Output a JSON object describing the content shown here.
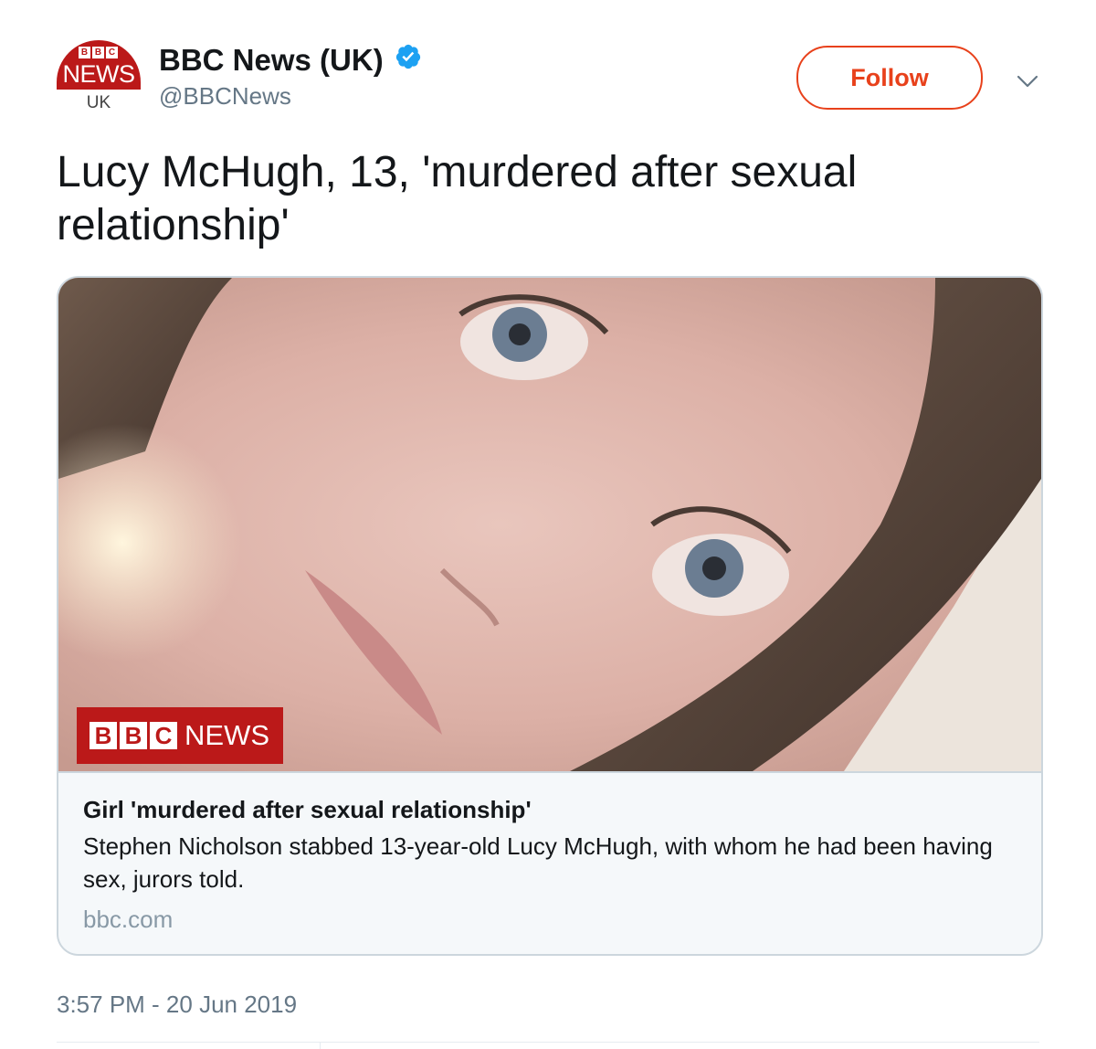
{
  "account": {
    "avatar": {
      "blocks": [
        "B",
        "B",
        "C"
      ],
      "word": "NEWS",
      "region": "UK"
    },
    "display_name": "BBC News (UK)",
    "verified": true,
    "handle": "@BBCNews"
  },
  "follow_label": "Follow",
  "tweet_text": "Lucy McHugh, 13, 'murdered after sexual relationship'",
  "card": {
    "image_watermark": {
      "blocks": [
        "B",
        "B",
        "C"
      ],
      "word": "NEWS"
    },
    "title": "Girl 'murdered after sexual relationship'",
    "description": "Stephen Nicholson stabbed 13-year-old Lucy McHugh, with whom he had been having sex, jurors told.",
    "domain": "bbc.com"
  },
  "timestamp": "3:57 PM - 20 Jun 2019",
  "colors": {
    "brand_red": "#bb1919",
    "follow_accent": "#e8411b",
    "verified_blue": "#1da1f2",
    "muted_text": "#657786"
  },
  "icons": [
    "verified-badge-icon",
    "chevron-down-icon"
  ]
}
